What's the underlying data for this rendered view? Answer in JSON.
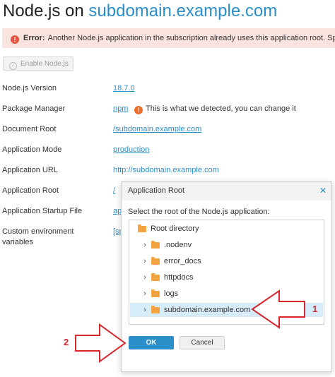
{
  "page": {
    "title_prefix": "Node.js on ",
    "title_domain": "subdomain.example.com"
  },
  "alert": {
    "icon": "error-icon",
    "label": "Error:",
    "message": "Another Node.js application in the subscription already uses this application root. Spec"
  },
  "enable_button": {
    "label": "Enable Node.js",
    "icon": "check-circle-icon"
  },
  "settings": [
    {
      "label": "Node.js Version",
      "value": "18.7.0"
    },
    {
      "label": "Package Manager",
      "value": "npm"
    },
    {
      "label": "Document Root",
      "value": "/subdomain.example.com"
    },
    {
      "label": "Application Mode",
      "value": "production"
    },
    {
      "label": "Application URL",
      "value": "http://subdomain.example.com"
    },
    {
      "label": "Application Root",
      "value": "/"
    },
    {
      "label": "Application Startup File",
      "value": "ap"
    },
    {
      "label": "Custom environment",
      "label2": "variables",
      "value": "[sp"
    }
  ],
  "package_manager_note": {
    "icon": "warning-icon",
    "text": "This is what we detected, you can change it"
  },
  "dialog": {
    "title": "Application Root",
    "close_icon": "close-icon",
    "prompt": "Select the root of the Node.js application:",
    "tree": {
      "root": "Root directory",
      "children": [
        ".nodenv",
        "error_docs",
        "httpdocs",
        "logs",
        "subdomain.example.com"
      ],
      "selected": "subdomain.example.com"
    },
    "ok_label": "OK",
    "cancel_label": "Cancel"
  },
  "annotations": {
    "marker1": "1",
    "marker2": "2",
    "color": "#d9262b"
  },
  "colors": {
    "accent": "#2b8ec9",
    "alert_bg": "#fbe3e0",
    "error_icon": "#e2543f",
    "warning_icon": "#ef6c2d",
    "folder": "#f1a441",
    "selection": "#d6ecf8"
  }
}
